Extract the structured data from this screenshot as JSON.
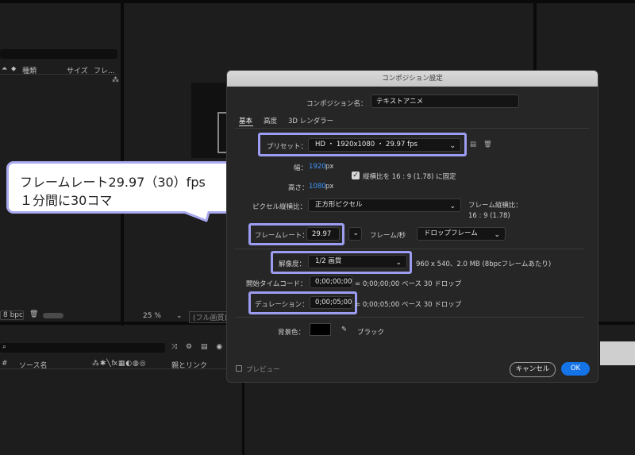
{
  "background": {
    "project_panel": {
      "columns": [
        "種類",
        "サイズ",
        "フレ..."
      ],
      "bpc_label": "8 bpc"
    },
    "viewer": {
      "zoom_label": "25 %",
      "resolution_label": "(フル画質)"
    },
    "timeline": {
      "search_placeholder": "",
      "source_name_header": "ソース名",
      "parent_link_header": "親とリンク",
      "switch_glyphs": "⁂ ✱ ╲ fx ▦ ◐ ◍ ◎"
    }
  },
  "callout": {
    "line1": "フレームレート29.97（30）fps",
    "line2": "１分間に30コマ"
  },
  "dialog": {
    "title": "コンポジション設定",
    "name_label": "コンポジション名：",
    "name_value": "テキストアニメ",
    "tabs": [
      "基本",
      "高度",
      "3D レンダラー"
    ],
    "active_tab": 0,
    "preset_label": "プリセット：",
    "preset_value": "HD ・ 1920x1080 ・ 29.97 fps",
    "width_label": "幅：",
    "width_value": "1920",
    "height_label": "高さ：",
    "height_value": "1080",
    "px_unit": "px",
    "lock_aspect_label": "縦横比を 16 : 9 (1.78) に固定",
    "lock_aspect_checked": true,
    "pixel_aspect_label": "ピクセル縦横比：",
    "pixel_aspect_value": "正方形ピクセル",
    "frame_aspect_label": "フレーム縦横比：",
    "frame_aspect_value": "16 : 9 (1.78)",
    "frame_rate_label": "フレームレート：",
    "frame_rate_value": "29.97",
    "fps_unit": "フレーム/秒",
    "drop_frame_value": "ドロップフレーム",
    "resolution_label": "解像度：",
    "resolution_value": "1/2 画質",
    "resolution_info": "960 x 540、2.0 MB (8bpcフレームあたり)",
    "start_tc_label": "開始タイムコード：",
    "start_tc_value": "0;00;00;00",
    "start_tc_info": "= 0;00;00;00  ベース 30   ドロップ",
    "duration_label": "デュレーション：",
    "duration_value": "0;00;05;00",
    "duration_info": "= 0;00;05;00  ベース 30   ドロップ",
    "bg_color_label": "背景色：",
    "bg_color_name": "ブラック",
    "bg_color_hex": "#000000",
    "preview_label": "プレビュー",
    "cancel_label": "キャンセル",
    "ok_label": "OK"
  },
  "colors": {
    "accent_blue": "#1473e6",
    "highlight_border": "#9c9cf0"
  }
}
